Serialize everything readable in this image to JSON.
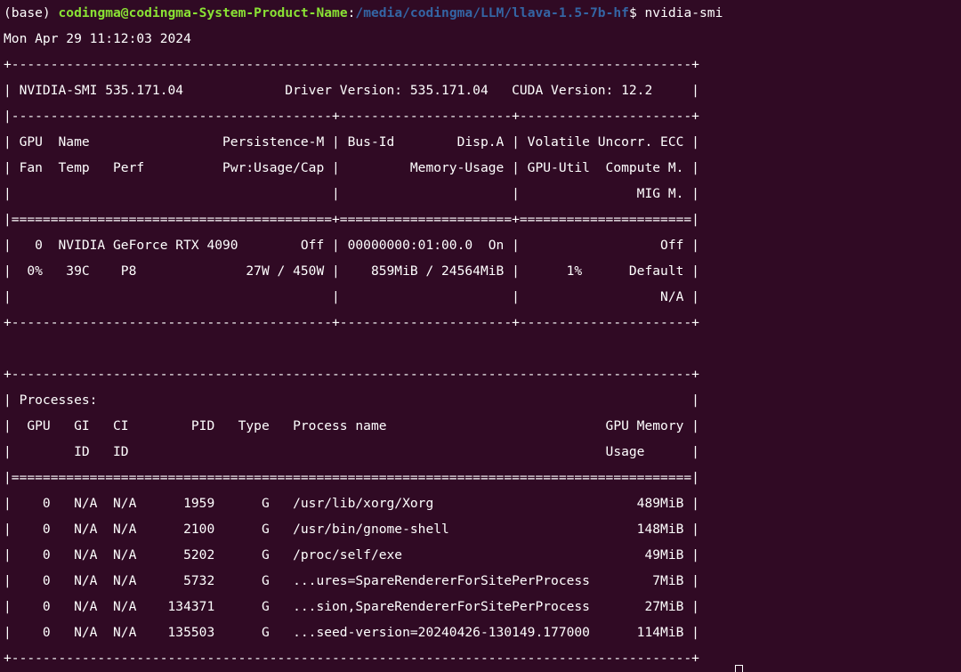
{
  "prompt": {
    "env": "(base) ",
    "user_host": "codingma@codingma-System-Product-Name",
    "colon": ":",
    "path": "/media/codingma/LLM/llava-1.5-7b-hf",
    "dollar": "$ ",
    "command": "nvidia-smi"
  },
  "lines": [
    "Mon Apr 29 11:12:03 2024",
    "+---------------------------------------------------------------------------------------+",
    "| NVIDIA-SMI 535.171.04             Driver Version: 535.171.04   CUDA Version: 12.2     |",
    "|-----------------------------------------+----------------------+----------------------+",
    "| GPU  Name                 Persistence-M | Bus-Id        Disp.A | Volatile Uncorr. ECC |",
    "| Fan  Temp   Perf          Pwr:Usage/Cap |         Memory-Usage | GPU-Util  Compute M. |",
    "|                                         |                      |               MIG M. |",
    "|=========================================+======================+======================|",
    "|   0  NVIDIA GeForce RTX 4090        Off | 00000000:01:00.0  On |                  Off |",
    "|  0%   39C    P8              27W / 450W |    859MiB / 24564MiB |      1%      Default |",
    "|                                         |                      |                  N/A |",
    "+-----------------------------------------+----------------------+----------------------+",
    "",
    "+---------------------------------------------------------------------------------------+",
    "| Processes:                                                                            |",
    "|  GPU   GI   CI        PID   Type   Process name                            GPU Memory |",
    "|        ID   ID                                                             Usage      |",
    "|=======================================================================================|",
    "|    0   N/A  N/A      1959      G   /usr/lib/xorg/Xorg                          489MiB |",
    "|    0   N/A  N/A      2100      G   /usr/bin/gnome-shell                        148MiB |",
    "|    0   N/A  N/A      5202      G   /proc/self/exe                               49MiB |",
    "|    0   N/A  N/A      5732      G   ...ures=SpareRendererForSitePerProcess        7MiB |",
    "|    0   N/A  N/A    134371      G   ...sion,SpareRendererForSitePerProcess       27MiB |",
    "|    0   N/A  N/A    135503      G   ...seed-version=20240426-130149.177000      114MiB |",
    "+---------------------------------------------------------------------------------------+"
  ]
}
